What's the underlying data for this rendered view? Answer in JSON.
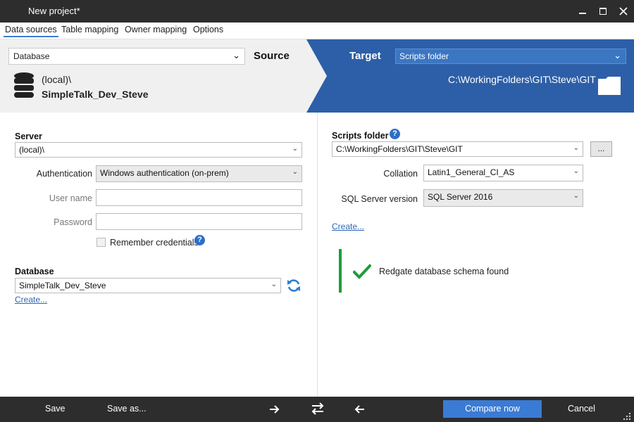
{
  "window": {
    "title": "New project*",
    "minimize_icon": "minimize-icon",
    "maximize_icon": "maximize-icon",
    "close_icon": "close-icon"
  },
  "tabs": [
    {
      "label": "Data sources",
      "active": true
    },
    {
      "label": "Table mapping",
      "active": false
    },
    {
      "label": "Owner mapping",
      "active": false
    },
    {
      "label": "Options",
      "active": false
    }
  ],
  "source": {
    "type_select": "Database",
    "heading": "Source",
    "server": "(local)\\",
    "database": "SimpleTalk_Dev_Steve"
  },
  "target": {
    "heading": "Target",
    "type_select": "Scripts folder",
    "path": "C:\\WorkingFolders\\GIT\\Steve\\GIT"
  },
  "left": {
    "server_label": "Server",
    "server_value": "(local)\\",
    "auth_label": "Authentication",
    "auth_value": "Windows authentication (on-prem)",
    "username_label": "User name",
    "username_value": "",
    "password_label": "Password",
    "password_value": "",
    "remember_label": "Remember credentials",
    "database_label": "Database",
    "database_value": "SimpleTalk_Dev_Steve",
    "create_link": "Create..."
  },
  "right": {
    "scripts_folder_label": "Scripts folder",
    "scripts_folder_value": "C:\\WorkingFolders\\GIT\\Steve\\GIT",
    "browse_label": "...",
    "collation_label": "Collation",
    "collation_value": "Latin1_General_CI_AS",
    "sqlver_label": "SQL Server version",
    "sqlver_value": "SQL Server 2016",
    "create_link": "Create...",
    "status_text": "Redgate database schema found"
  },
  "bottom": {
    "save": "Save",
    "save_as": "Save as...",
    "compare": "Compare now",
    "cancel": "Cancel"
  },
  "colors": {
    "accent": "#3a7bd5",
    "target_bg": "#2d5fa8",
    "success": "#1e9c3b",
    "titlebar": "#2d2d2d"
  }
}
